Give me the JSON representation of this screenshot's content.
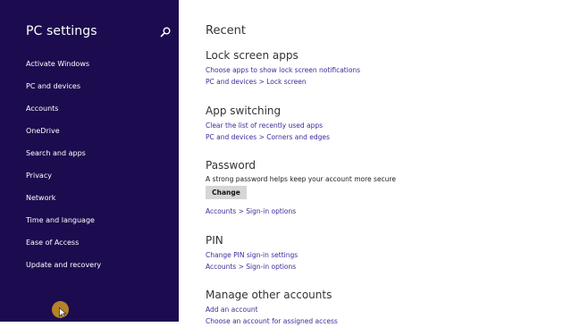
{
  "sidebar": {
    "title": "PC settings",
    "items": [
      {
        "label": "Activate Windows"
      },
      {
        "label": "PC and devices"
      },
      {
        "label": "Accounts"
      },
      {
        "label": "OneDrive"
      },
      {
        "label": "Search and apps"
      },
      {
        "label": "Privacy"
      },
      {
        "label": "Network"
      },
      {
        "label": "Time and language"
      },
      {
        "label": "Ease of Access"
      },
      {
        "label": "Update and recovery"
      }
    ]
  },
  "main": {
    "title": "Recent",
    "lock_screen": {
      "heading": "Lock screen apps",
      "link1": "Choose apps to show lock screen notifications",
      "link2": "PC and devices > Lock screen"
    },
    "app_switching": {
      "heading": "App switching",
      "link1": "Clear the list of recently used apps",
      "link2": "PC and devices > Corners and edges"
    },
    "password": {
      "heading": "Password",
      "description": "A strong password helps keep your account more secure",
      "button": "Change",
      "link": "Accounts > Sign-in options"
    },
    "pin": {
      "heading": "PIN",
      "link1": "Change PIN sign-in settings",
      "link2": "Accounts > Sign-in options"
    },
    "manage_accounts": {
      "heading": "Manage other accounts",
      "link1": "Add an account",
      "link2": "Choose an account for assigned access"
    }
  },
  "colors": {
    "sidebar_bg": "#1c0b4f",
    "link": "#3f2a9a",
    "cursor_highlight": "#c58f23"
  }
}
